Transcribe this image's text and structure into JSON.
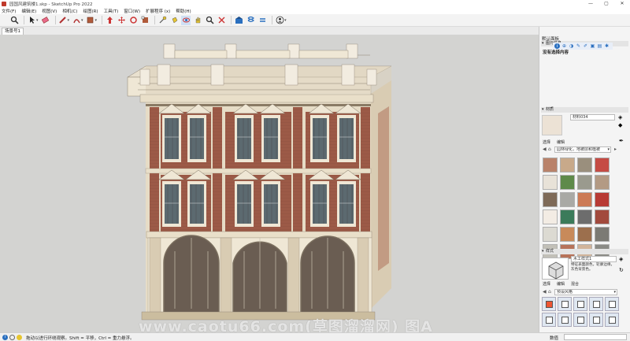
{
  "window": {
    "title": "园国风建筑楼1.skp - SketchUp Pro 2022",
    "buttons": [
      "—",
      "▢",
      "✕"
    ]
  },
  "menu": [
    "文件(F)",
    "编辑(E)",
    "视图(V)",
    "相机(C)",
    "绘图(R)",
    "工具(T)",
    "窗口(W)",
    "扩展程序 (x)",
    "帮助(H)"
  ],
  "toolbar": {
    "icons": [
      "search-icon",
      "select-icon",
      "eraser-icon",
      "pencil-icon",
      "arc-icon",
      "shape-icon",
      "pushpull-icon",
      "move-icon",
      "rotate-icon",
      "scale-icon",
      "tape-icon",
      "paint-icon",
      "orbit-icon",
      "pan-icon",
      "zoom-icon",
      "zoom-extents-icon",
      "warehouse-icon",
      "extension-icon",
      "layout-icon",
      "user-icon"
    ]
  },
  "scene_tab": "场景号1",
  "tray": {
    "title": "默认面板",
    "entity_info": {
      "header": "图元信息",
      "label": "没有选择内容"
    },
    "materials": {
      "header": "材质",
      "name_value": "材料034",
      "tabs": [
        "选择",
        "编辑"
      ],
      "collection": "园林绿化，地被层和植被",
      "swatch_colors": [
        "#b9826a",
        "#c8a98a",
        "#9a8f7d",
        "#c54b44",
        "#e8e2d8",
        "#5e8a4a",
        "#9a9a8e",
        "#b39a84",
        "#7e6a58",
        "#a9a9a5",
        "#cc7a55",
        "#b83b35",
        "#f3ece4",
        "#3b7b5a",
        "#6d6d6d",
        "#a24a3d",
        "#dcdad2",
        "#c88a5a",
        "#9c6f4d",
        "#7b7a74",
        "#c2c0b8",
        "#b7735a",
        "#d1b49a",
        "#8b8b86"
      ]
    },
    "styles": {
      "header": "样式",
      "name_value": "木工样式1",
      "description": "特征表面颜色，轮廓边缘，灰色背景色。",
      "tabs": [
        "选择",
        "编辑",
        "混合"
      ],
      "collection": "预设风格"
    }
  },
  "status": {
    "text": "拖动以进行环绕观察。Shift = 平移，Ctrl = 重力悬浮。",
    "measurements_label": "数值"
  },
  "watermark": "www.caotu66.com(草图溜溜网) 图A",
  "colors": {
    "viewport_bg": "#d3d3d1",
    "brick": "#9c5a47",
    "stone": "#e6dcc6",
    "dark_stone": "#cbbd9f",
    "accent": "#2a6fbf"
  }
}
